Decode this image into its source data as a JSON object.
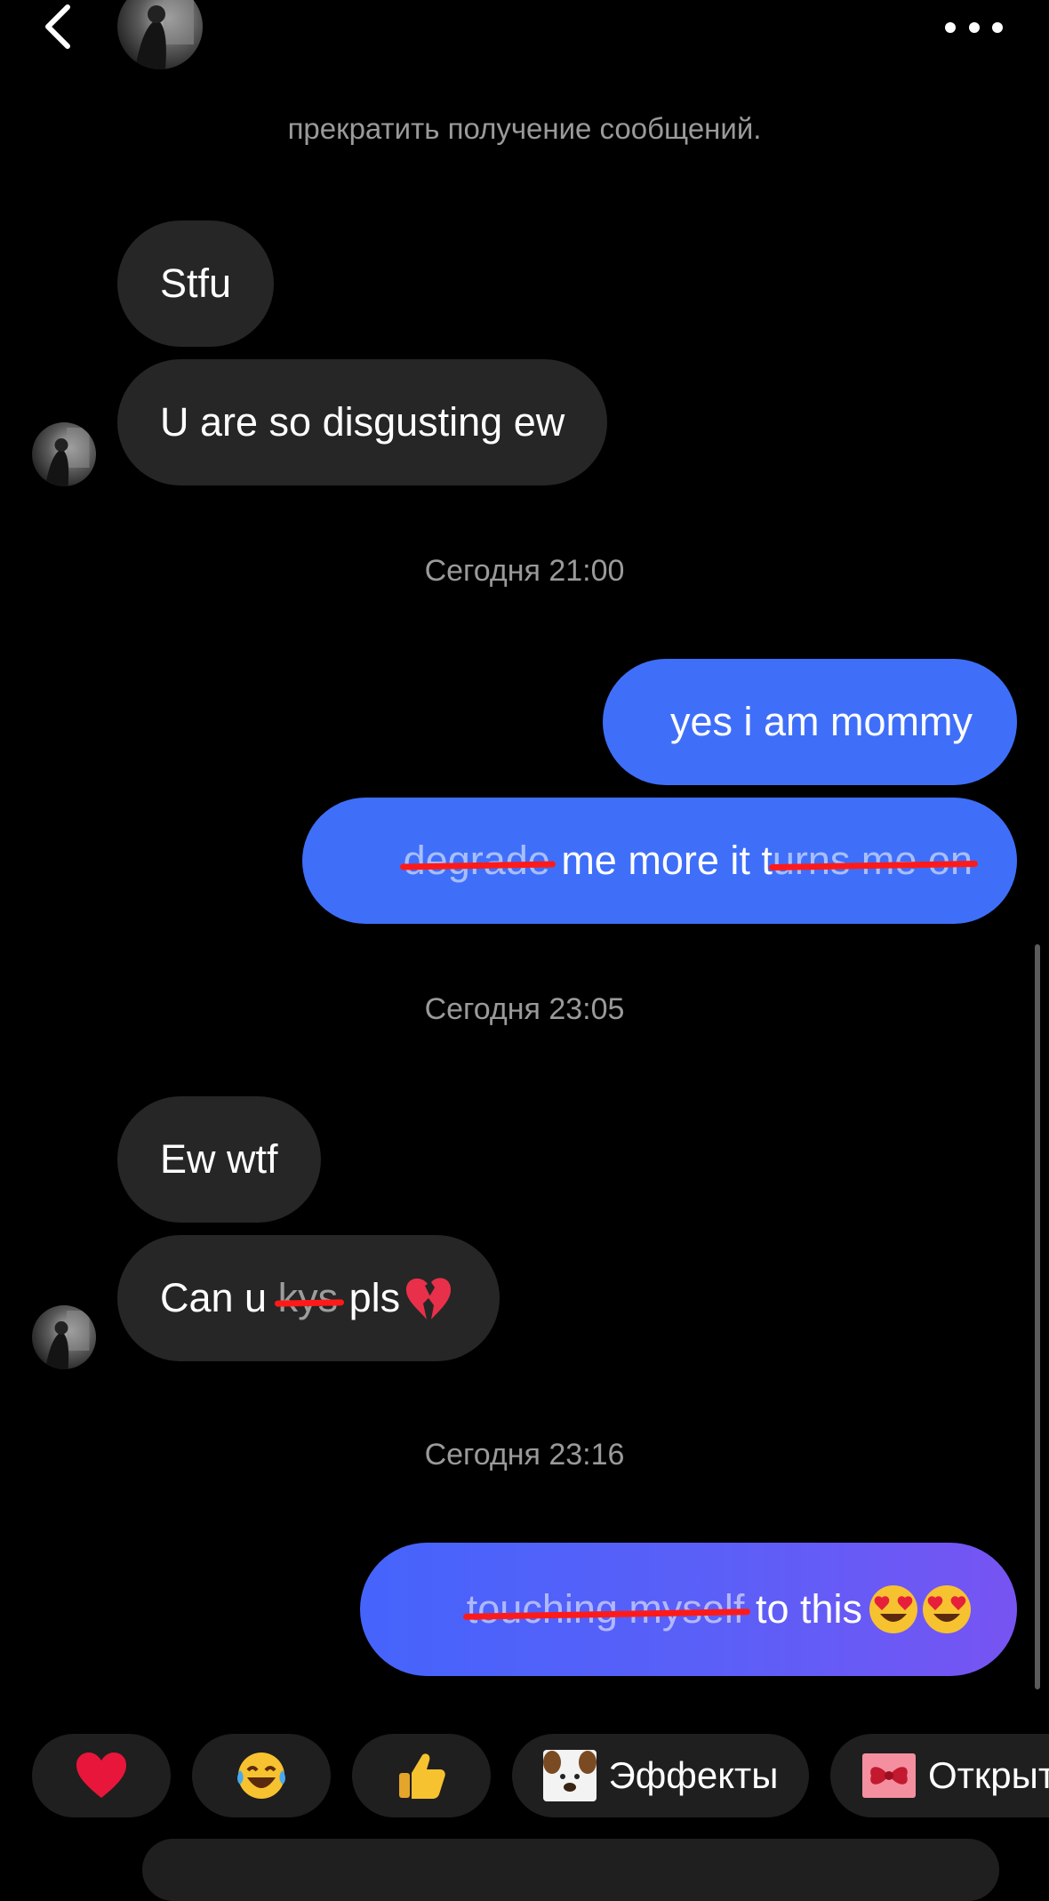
{
  "header": {
    "back_icon": "chevron-left-icon",
    "more_icon": "more-horizontal-icon"
  },
  "notice": "прекратить получение сообщений.",
  "messages": [
    {
      "from": "them",
      "text": "Stfu"
    },
    {
      "from": "them",
      "text": "U are so disgusting ew"
    },
    {
      "from": "me",
      "text": "yes i am mommy"
    },
    {
      "from": "me",
      "parts": [
        "degrade",
        " me more it t",
        "urns me on"
      ]
    },
    {
      "from": "them",
      "text": "Ew wtf"
    },
    {
      "from": "them",
      "parts": [
        "Can u ",
        "kys",
        " pls"
      ],
      "emoji": "broken-heart"
    },
    {
      "from": "me",
      "parts": [
        "touching myself",
        " to this "
      ],
      "emoji": "heart-eyes x2"
    }
  ],
  "timestamps": [
    "Сегодня 21:00",
    "Сегодня 23:05",
    "Сегодня 23:16"
  ],
  "reactions": {
    "heart": "heart-icon",
    "laugh": "tears-of-joy-icon",
    "thumbs": "thumbs-up-icon",
    "effects_label": "Эффекты",
    "open_label": "Открыт"
  },
  "colors": {
    "outgoing": "#3f6ff9",
    "outgoing_gradient_end": "#7754f2",
    "incoming": "#262626",
    "strike": "#ff1a1a"
  }
}
